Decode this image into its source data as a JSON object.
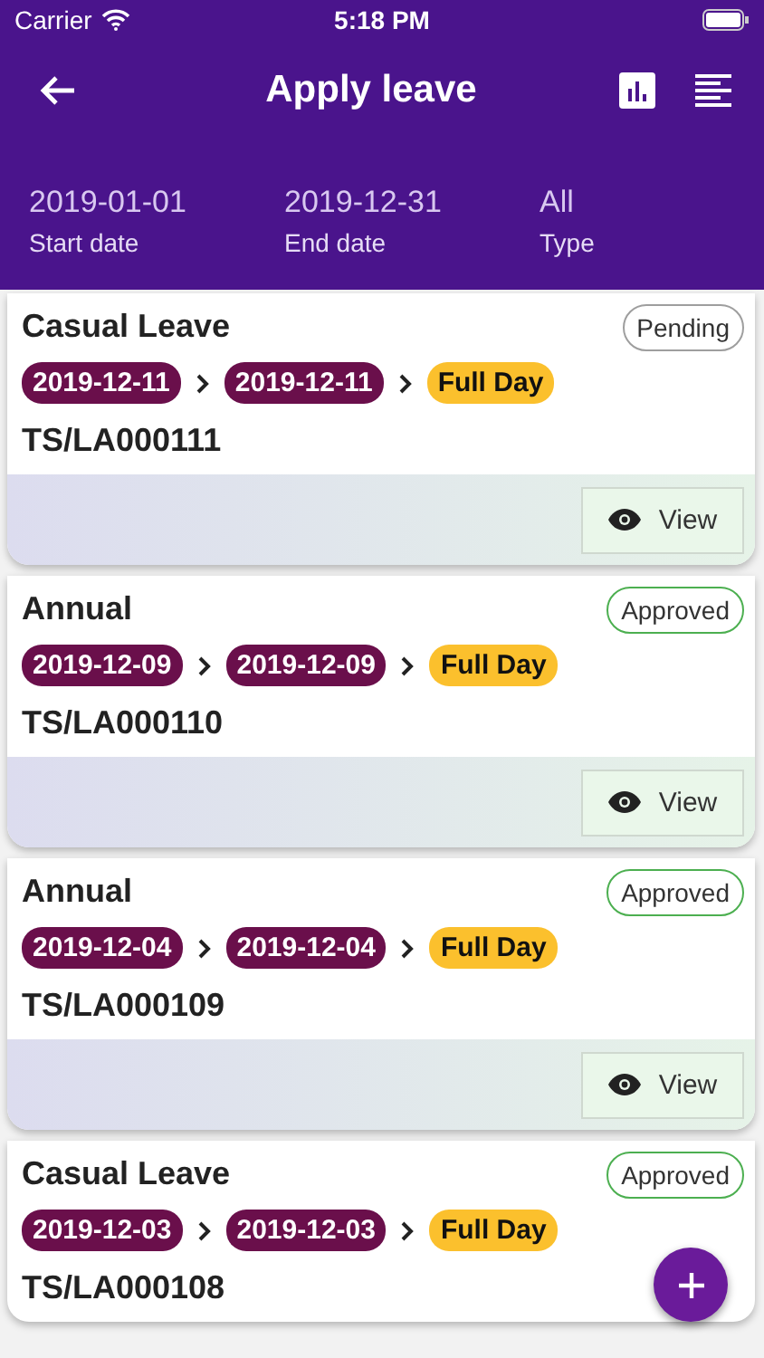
{
  "status_bar": {
    "carrier": "Carrier",
    "time": "5:18 PM"
  },
  "header": {
    "title": "Apply leave"
  },
  "filters": [
    {
      "value": "2019-01-01",
      "label": "Start date"
    },
    {
      "value": "2019-12-31",
      "label": "End date"
    },
    {
      "value": "All",
      "label": "Type"
    }
  ],
  "leaves": [
    {
      "type": "Casual Leave",
      "status": "Pending",
      "approved": false,
      "from": "2019-12-11",
      "to": "2019-12-11",
      "duration": "Full Day",
      "id": "TS/LA000111",
      "action": "View"
    },
    {
      "type": "Annual",
      "status": "Approved",
      "approved": true,
      "from": "2019-12-09",
      "to": "2019-12-09",
      "duration": "Full Day",
      "id": "TS/LA000110",
      "action": "View"
    },
    {
      "type": "Annual",
      "status": "Approved",
      "approved": true,
      "from": "2019-12-04",
      "to": "2019-12-04",
      "duration": "Full Day",
      "id": "TS/LA000109",
      "action": "View"
    },
    {
      "type": "Casual Leave",
      "status": "Approved",
      "approved": true,
      "from": "2019-12-03",
      "to": "2019-12-03",
      "duration": "Full Day",
      "id": "TS/LA000108"
    }
  ]
}
